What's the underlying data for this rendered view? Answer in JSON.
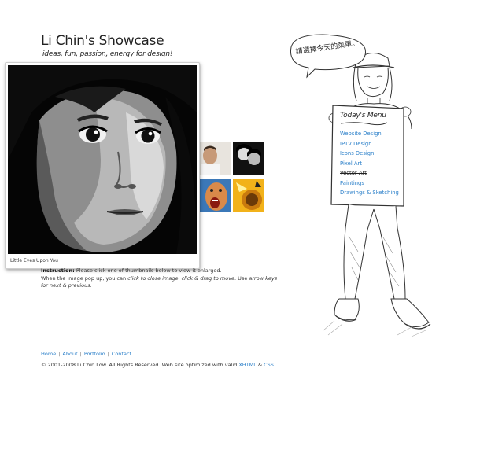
{
  "header": {
    "title": "Li Chin's Showcase",
    "tagline": "ideas, fun, passion, energy for design!"
  },
  "popup": {
    "caption": "Little Eyes Upon You"
  },
  "instruction": {
    "label": "Instruction:",
    "line1": "Please click one of thumbnails below to view it enlarged.",
    "line2_a": "When the image pop up, you can ",
    "line2_b": "click to close image",
    "line2_c": ", ",
    "line2_d": "click & drag to move",
    "line2_e": ". Use ",
    "line2_f": "arrow keys for next & previous",
    "line2_g": "."
  },
  "speech_bubble": {
    "text": "請選擇今天的菜單。"
  },
  "menu": {
    "title": "Today's Menu",
    "items": [
      {
        "label": "Website Design",
        "struck": false
      },
      {
        "label": "IPTV Design",
        "struck": false
      },
      {
        "label": "Icons Design",
        "struck": false
      },
      {
        "label": "Pixel Art",
        "struck": false
      },
      {
        "label": "Vector Art",
        "struck": true
      },
      {
        "label": "Paintings",
        "struck": false
      },
      {
        "label": "Drawings & Sketching",
        "struck": false
      }
    ]
  },
  "footer": {
    "nav": [
      "Home",
      "About",
      "Portfolio",
      "Contact"
    ],
    "separator": "|",
    "copyright_a": "© 2001-2008 Li Chin Low. All Rights Reserved. Web site optimized with valid ",
    "copyright_xhtml": "XHTML",
    "copyright_and": " & ",
    "copyright_css": "CSS",
    "copyright_end": "."
  },
  "colors": {
    "link": "#2a7fc9",
    "text": "#333333",
    "background": "#ffffff"
  }
}
